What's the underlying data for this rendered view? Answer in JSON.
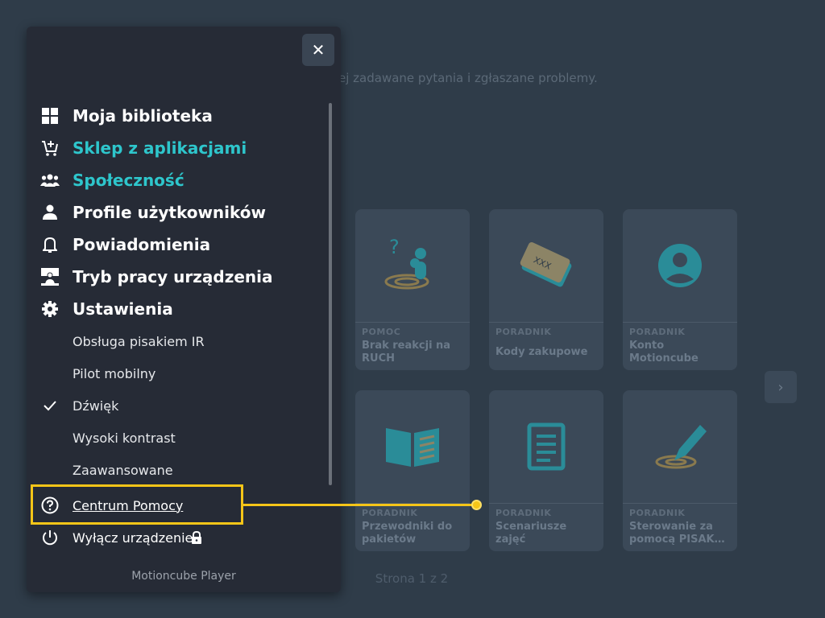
{
  "background": {
    "description_fragment": "ej zadawane pytania i zgłaszane problemy.",
    "cards": [
      {
        "category": "POMOC",
        "title": "Brak reakcji na RUCH",
        "icon": "question-person-icon"
      },
      {
        "category": "PORADNIK",
        "title": "Kody zakupowe",
        "icon": "ticket-icon"
      },
      {
        "category": "PORADNIK",
        "title": "Konto Motioncube",
        "icon": "account-icon"
      },
      {
        "category": "PORADNIK",
        "title": "Przewodniki do pakietów",
        "icon": "book-icon"
      },
      {
        "category": "PORADNIK",
        "title": "Scenariusze zajęć",
        "icon": "document-icon"
      },
      {
        "category": "PORADNIK",
        "title": "Sterowanie za pomocą PISAK…",
        "icon": "pen-icon"
      }
    ],
    "next_arrow": "›",
    "page_indicator": "Strona 1 z 2"
  },
  "drawer": {
    "close_symbol": "✕",
    "menu": [
      {
        "label": "Moja biblioteka",
        "icon": "grid-icon"
      },
      {
        "label": "Sklep z aplikacjami",
        "icon": "cart-add-icon"
      },
      {
        "label": "Społeczność",
        "icon": "community-icon"
      },
      {
        "label": "Profile użytkowników",
        "icon": "person-icon"
      },
      {
        "label": "Powiadomienia",
        "icon": "bell-icon"
      },
      {
        "label": "Tryb pracy urządzenia",
        "icon": "device-mode-icon"
      },
      {
        "label": "Ustawienia",
        "icon": "gear-icon"
      }
    ],
    "settings": [
      {
        "label": "Obsługa pisakiem IR"
      },
      {
        "label": "Pilot mobilny"
      },
      {
        "label": "Dźwięk",
        "checked": true
      },
      {
        "label": "Wysoki kontrast"
      },
      {
        "label": "Zaawansowane"
      }
    ],
    "help": {
      "label": "Centrum Pomocy",
      "icon": "help-circle-icon"
    },
    "power": {
      "label": "Wyłącz urządzenie",
      "icon": "power-icon",
      "lock_icon": "lock-icon"
    },
    "footer": "Motioncube Player"
  },
  "colors": {
    "accent": "#2ec6cc",
    "highlight": "#f5c518",
    "drawer_bg": "#262b36"
  }
}
